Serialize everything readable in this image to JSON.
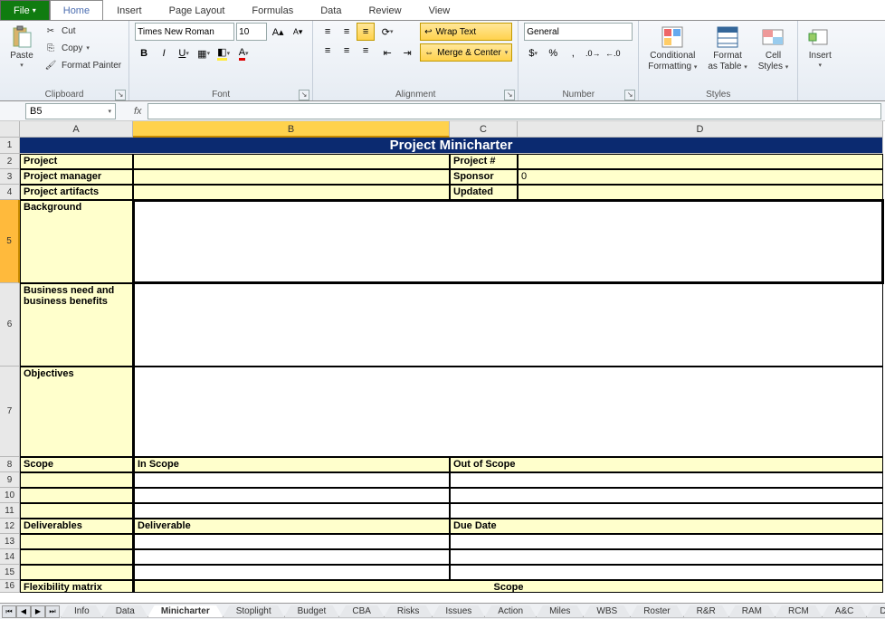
{
  "tabs": {
    "file": "File",
    "home": "Home",
    "insert": "Insert",
    "page_layout": "Page Layout",
    "formulas": "Formulas",
    "data": "Data",
    "review": "Review",
    "view": "View"
  },
  "clipboard": {
    "paste": "Paste",
    "cut": "Cut",
    "copy": "Copy",
    "format_painter": "Format Painter",
    "label": "Clipboard"
  },
  "font": {
    "name": "Times New Roman",
    "size": "10",
    "label": "Font"
  },
  "alignment": {
    "wrap": "Wrap Text",
    "merge": "Merge & Center",
    "label": "Alignment"
  },
  "number": {
    "format": "General",
    "label": "Number"
  },
  "styles": {
    "conditional": "Conditional",
    "conditional2": "Formatting",
    "format_table": "Format",
    "format_table2": "as Table",
    "cell": "Cell",
    "cell2": "Styles",
    "label": "Styles"
  },
  "cells": {
    "insert": "Insert"
  },
  "namebox": "B5",
  "fx": "fx",
  "columns": [
    "A",
    "B",
    "C",
    "D"
  ],
  "rows": [
    "1",
    "2",
    "3",
    "4",
    "5",
    "6",
    "7",
    "8",
    "9",
    "10",
    "11",
    "12",
    "13",
    "14",
    "15",
    "16"
  ],
  "sheet": {
    "title": "Project Minicharter",
    "r2a": "Project",
    "r2c": "Project #",
    "r3a": "Project manager",
    "r3c": "Sponsor",
    "r3d": "0",
    "r4a": "Project artifacts",
    "r4c": "Updated",
    "r5a": "Background",
    "r6a": "Business need and business benefits",
    "r7a": "Objectives",
    "r8a": "Scope",
    "r8b": "In Scope",
    "r8c": "Out of Scope",
    "r12a": "Deliverables",
    "r12b": "Deliverable",
    "r12c": "Due Date",
    "r16a": "Flexibility matrix",
    "r16b": "Scope"
  },
  "sheets": [
    "Info",
    "Data",
    "Minicharter",
    "Stoplight",
    "Budget",
    "CBA",
    "Risks",
    "Issues",
    "Action",
    "Miles",
    "WBS",
    "Roster",
    "R&R",
    "RAM",
    "RCM",
    "A&C",
    "Decision"
  ]
}
